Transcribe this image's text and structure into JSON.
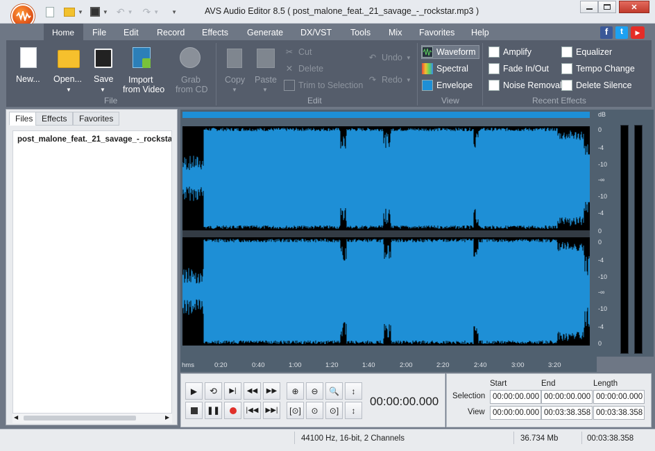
{
  "window": {
    "title": "AVS Audio Editor 8.5  ( post_malone_feat._21_savage_-_rockstar.mp3 )"
  },
  "menu": {
    "tabs": [
      "Home",
      "File",
      "Edit",
      "Record",
      "Effects",
      "Generate",
      "DX/VST",
      "Tools",
      "Mix",
      "Favorites",
      "Help"
    ]
  },
  "ribbon": {
    "file": {
      "new": "New...",
      "open": "Open...",
      "save": "Save",
      "import_line1": "Import",
      "import_line2": "from Video",
      "grab_line1": "Grab",
      "grab_line2": "from CD",
      "group": "File"
    },
    "edit": {
      "copy": "Copy",
      "paste": "Paste",
      "cut": "Cut",
      "delete": "Delete",
      "trim": "Trim to Selection",
      "undo": "Undo",
      "redo": "Redo",
      "group": "Edit"
    },
    "view": {
      "waveform": "Waveform",
      "spectral": "Spectral",
      "envelope": "Envelope",
      "group": "View"
    },
    "recent": {
      "amplify": "Amplify",
      "fade": "Fade In/Out",
      "noise": "Noise Removal",
      "equalizer": "Equalizer",
      "tempo": "Tempo Change",
      "silence": "Delete Silence",
      "group": "Recent Effects"
    }
  },
  "panel": {
    "tabs": [
      "Files",
      "Effects",
      "Favorites"
    ],
    "file_item": "post_malone_feat._21_savage_-_rockstar.mp3"
  },
  "db_scale": {
    "unit": "dB",
    "ch1": [
      "0",
      "-4",
      "-10",
      "-∞",
      "-10",
      "-4",
      "0"
    ],
    "ch2": [
      "0",
      "-4",
      "-10",
      "-∞",
      "-10",
      "-4",
      "0"
    ]
  },
  "timeline": {
    "unit": "hms",
    "labels": [
      "0:20",
      "0:40",
      "1:00",
      "1:20",
      "1:40",
      "2:00",
      "2:20",
      "2:40",
      "3:00",
      "3:20"
    ]
  },
  "transport": {
    "time": "00:00:00.000"
  },
  "selection": {
    "headers": {
      "start": "Start",
      "end": "End",
      "length": "Length"
    },
    "selection_label": "Selection",
    "view_label": "View",
    "selection_start": "00:00:00.000",
    "selection_end": "00:00:00.000",
    "selection_length": "00:00:00.000",
    "view_start": "00:00:00.000",
    "view_end": "00:03:38.358",
    "view_length": "00:03:38.358"
  },
  "status": {
    "format": "44100 Hz, 16-bit, 2 Channels",
    "size": "36.734 Mb",
    "duration": "00:03:38.358"
  },
  "colors": {
    "waveform": "#1e8fd6",
    "ribbon": "#555d6b",
    "background": "#6e7785"
  }
}
